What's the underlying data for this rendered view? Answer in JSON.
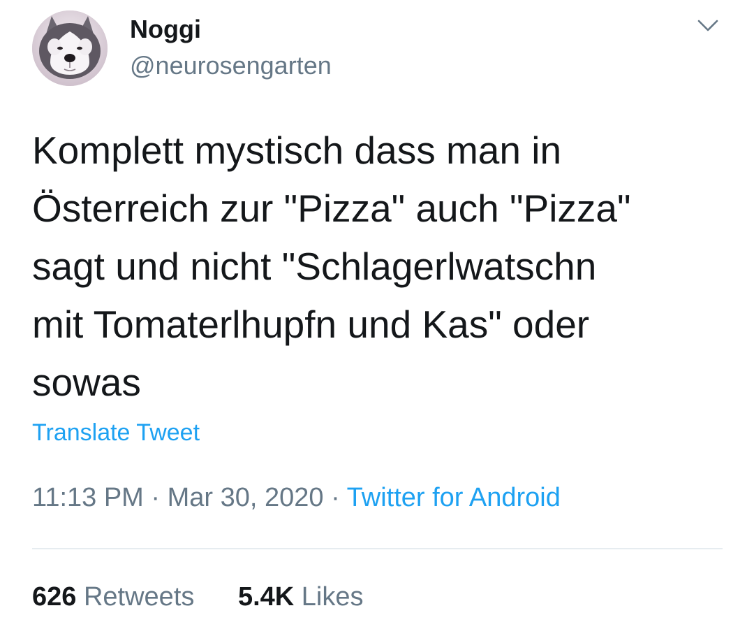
{
  "user": {
    "display_name": "Noggi",
    "handle": "@neurosengarten",
    "avatar_icon": "husky-avatar"
  },
  "tweet": {
    "text_lines": [
      "Komplett mystisch dass man in",
      "Österreich zur \"Pizza\" auch \"Pizza\"",
      "sagt und nicht \"Schlagerlwatschn",
      "mit Tomaterlhupfn und Kas\" oder",
      "sowas"
    ],
    "translate_label": "Translate Tweet",
    "time": "11:13 PM",
    "date": "Mar 30, 2020",
    "separator": "·",
    "source": "Twitter for Android"
  },
  "stats": {
    "retweets_count": "626",
    "retweets_label": "Retweets",
    "likes_count": "5.4K",
    "likes_label": "Likes"
  },
  "colors": {
    "text": "#14171a",
    "secondary": "#657786",
    "link": "#1da1f2",
    "divider": "#e6ecf0"
  }
}
